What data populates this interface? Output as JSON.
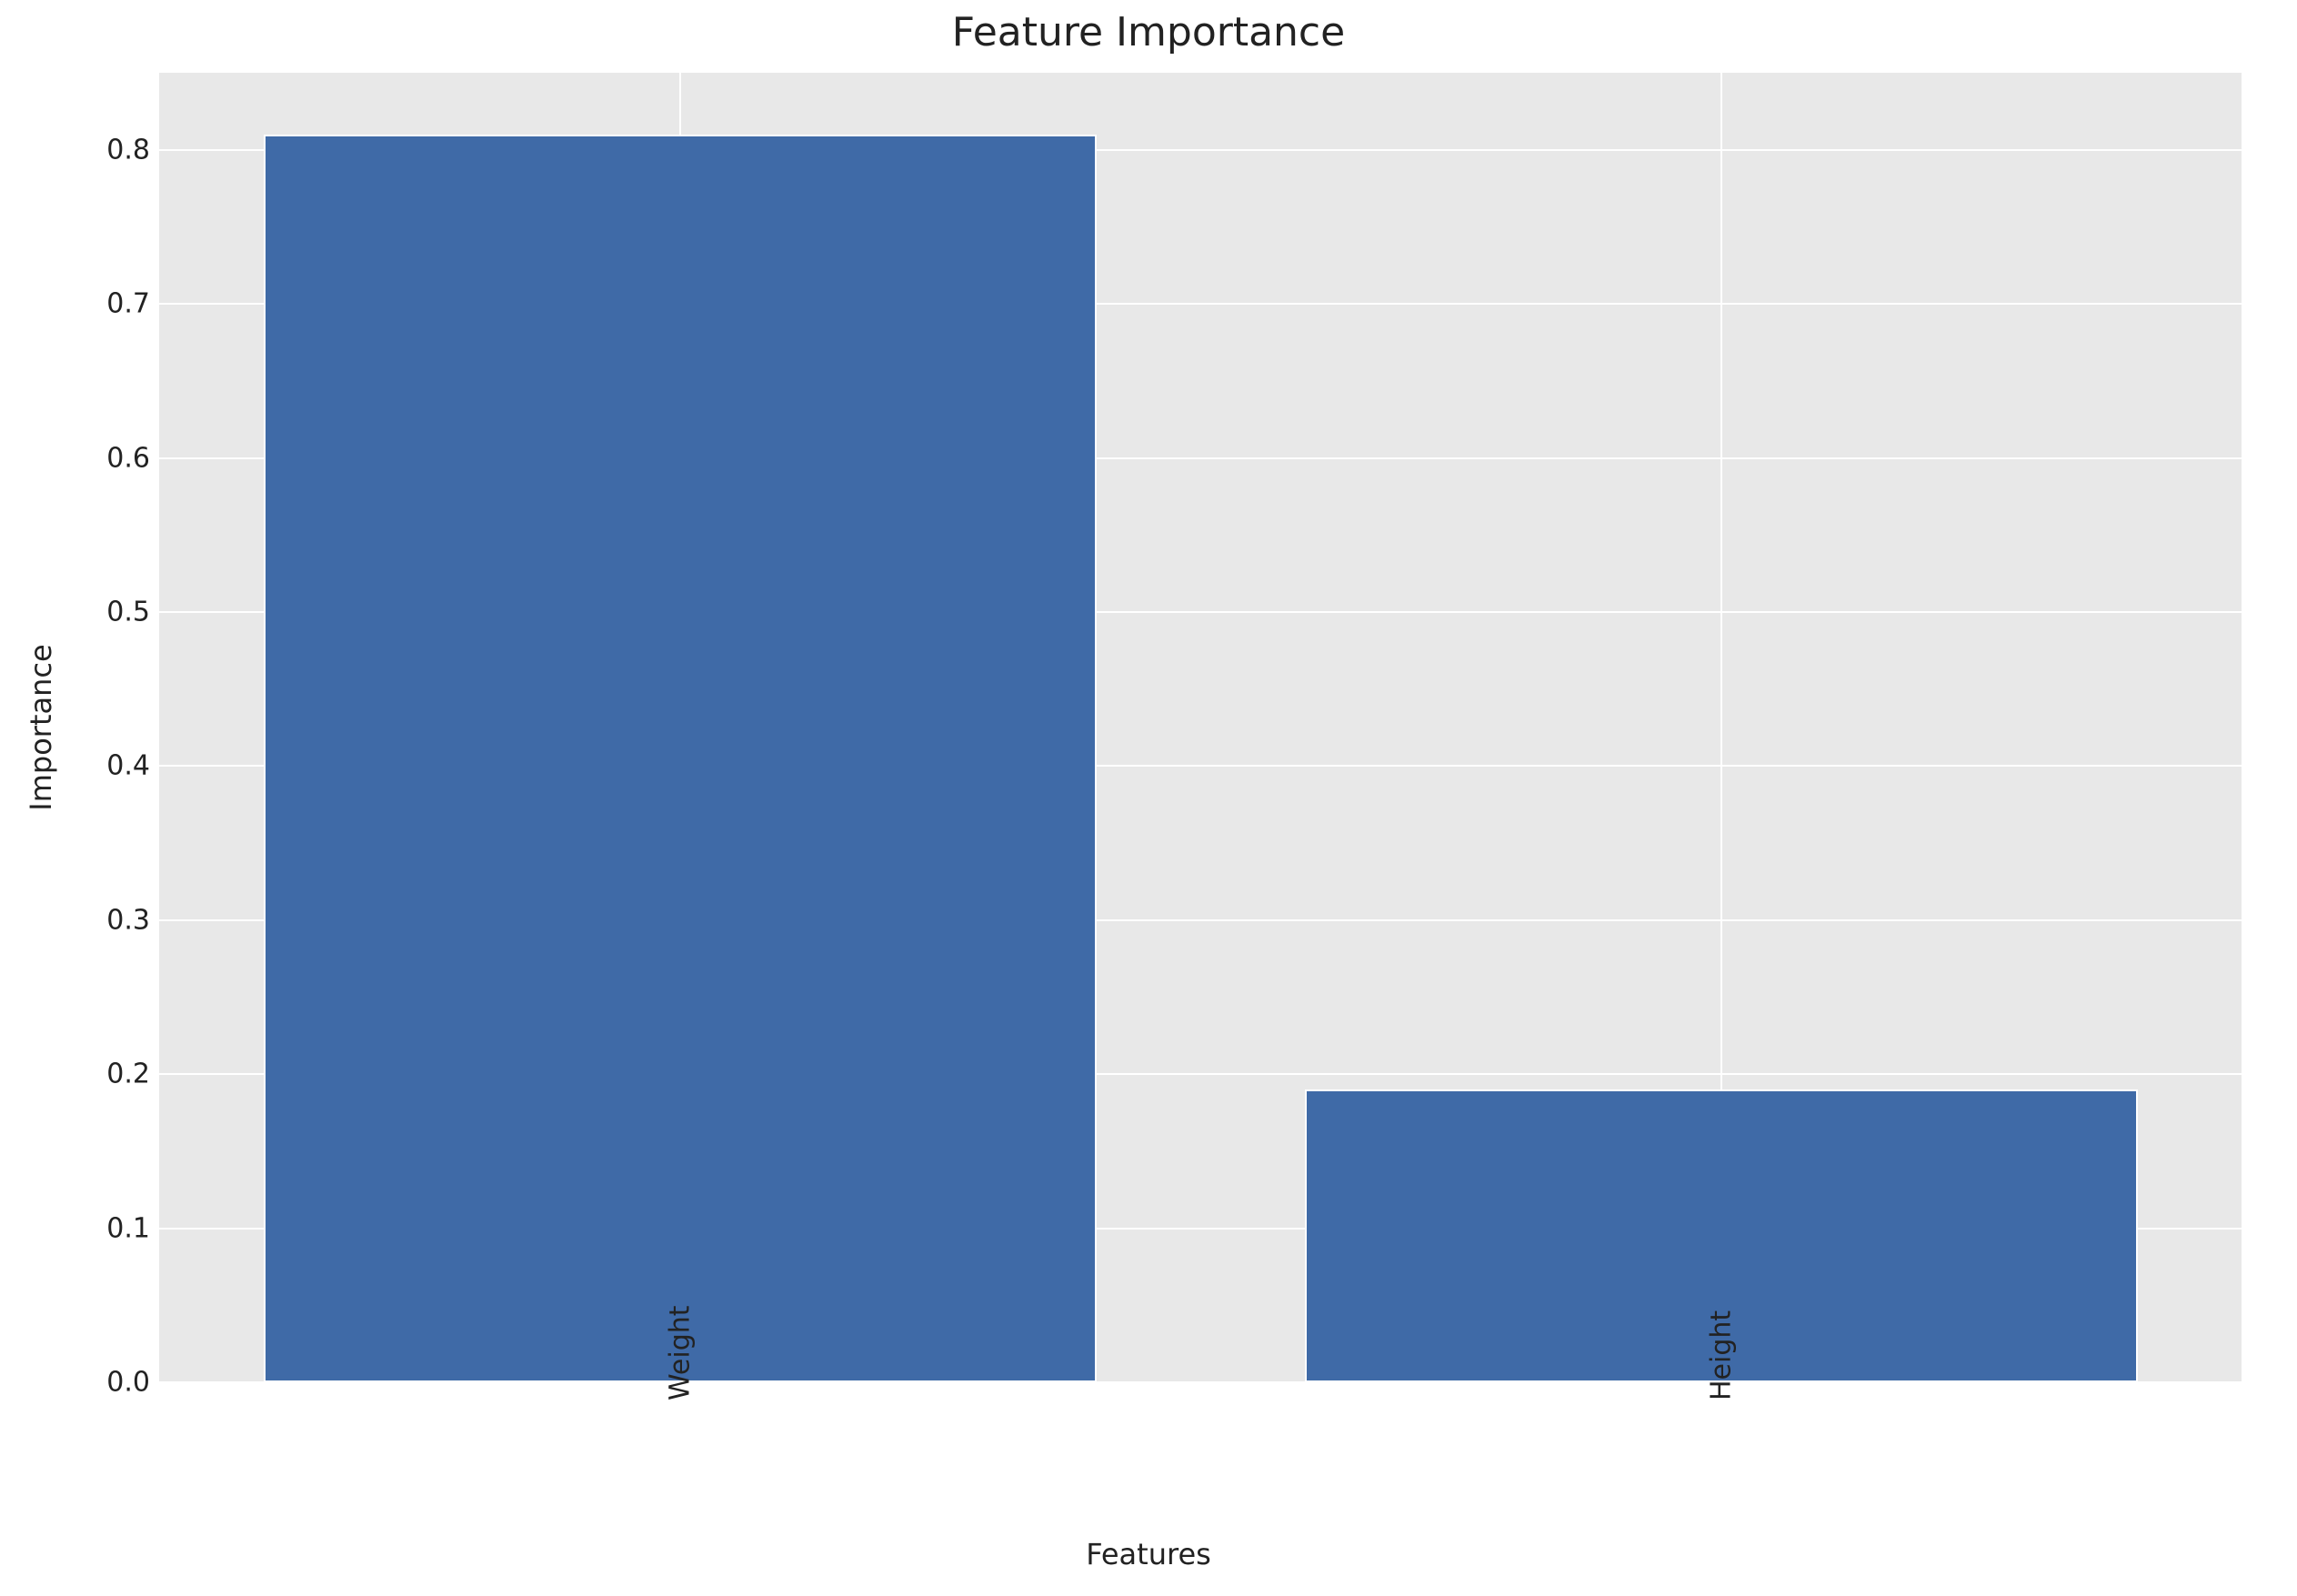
{
  "chart_data": {
    "type": "bar",
    "title": "Feature Importance",
    "xlabel": "Features",
    "ylabel": "Importance",
    "categories": [
      "Weight",
      "Height"
    ],
    "values": [
      0.81,
      0.19
    ],
    "ylim": [
      0.0,
      0.85
    ],
    "yticks": [
      0.0,
      0.1,
      0.2,
      0.3,
      0.4,
      0.5,
      0.6,
      0.7,
      0.8
    ],
    "ytick_labels": [
      "0.0",
      "0.1",
      "0.2",
      "0.3",
      "0.4",
      "0.5",
      "0.6",
      "0.7",
      "0.8"
    ],
    "colors": {
      "bar": "#3f6aa7",
      "plot_bg": "#e8e8e8",
      "grid": "#ffffff"
    }
  }
}
